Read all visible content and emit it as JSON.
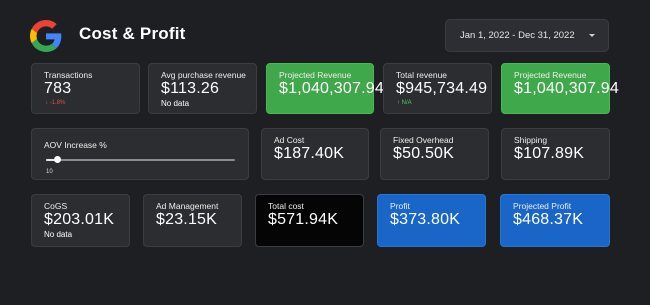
{
  "header": {
    "title": "Cost & Profit",
    "date_range": "Jan 1, 2022 - Dec 31, 2022",
    "logo": "google-g-logo",
    "dropdown_icon": "caret-down-icon"
  },
  "colors": {
    "background": "#1e1f22",
    "card": "#2b2d31",
    "green": "#3fa84a",
    "blue": "#1a66c8",
    "black": "#050505",
    "negative": "#d9534f",
    "positive": "#5cc46a"
  },
  "row1": {
    "transactions": {
      "label": "Transactions",
      "value": "783",
      "delta": "↓ -1.8%"
    },
    "avg_purchase": {
      "label": "Avg purchase revenue",
      "value": "$113.26",
      "sub": "No data"
    },
    "projected_revenue_1": {
      "label": "Projected Revenue",
      "value": "$1,040,307.94"
    },
    "total_revenue": {
      "label": "Total revenue",
      "value": "$945,734.49",
      "delta": "↑ N/A"
    },
    "projected_revenue_2": {
      "label": "Projected Revenue",
      "value": "$1,040,307.94"
    }
  },
  "row2": {
    "aov": {
      "label": "AOV Increase %",
      "slider_value": "10",
      "slider_fraction": 0.05
    },
    "ad_cost": {
      "label": "Ad Cost",
      "value": "$187.40K"
    },
    "fixed_overhead": {
      "label": "Fixed Overhead",
      "value": "$50.50K"
    },
    "shipping": {
      "label": "Shipping",
      "value": "$107.89K"
    }
  },
  "row3": {
    "cogs": {
      "label": "CoGS",
      "value": "$203.01K",
      "sub": "No data"
    },
    "ad_management": {
      "label": "Ad Management",
      "value": "$23.15K"
    },
    "total_cost": {
      "label": "Total cost",
      "value": "$571.94K"
    },
    "profit": {
      "label": "Profit",
      "value": "$373.80K"
    },
    "projected_profit": {
      "label": "Projected Profit",
      "value": "$468.37K"
    }
  }
}
